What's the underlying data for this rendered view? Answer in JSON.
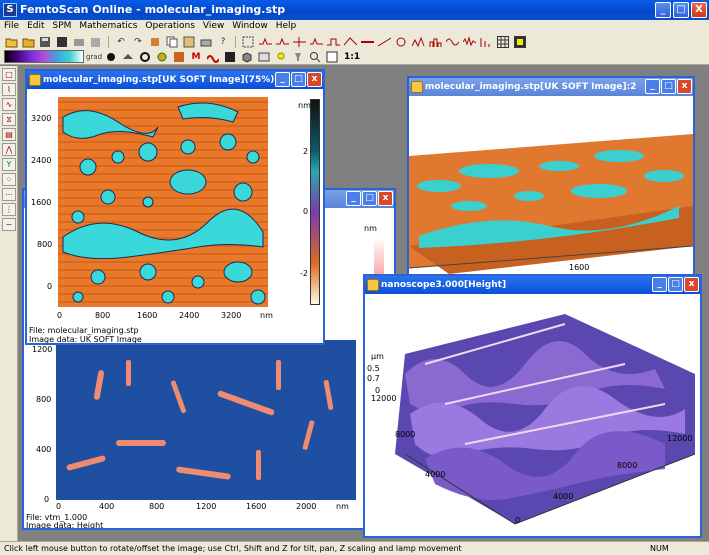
{
  "app": {
    "title": "FemtoScan Online - molecular_imaging.stp",
    "icon": "app-icon"
  },
  "window_buttons": [
    "_",
    "□",
    "X"
  ],
  "menu": [
    "File",
    "Edit",
    "SPM",
    "Mathematics",
    "Operations",
    "View",
    "Window",
    "Help"
  ],
  "toolbar": {
    "zoom_label": "1:1",
    "grad_label": "grad"
  },
  "status": {
    "text": "Click left mouse button to rotate/offset the image; use Ctrl, Shift and Z for tilt, pan, Z scaling and lamp movement",
    "num": "NUM"
  },
  "win1": {
    "title": "molecular_imaging.stp[UK SOFT Image](75%):1",
    "y_ticks": [
      "3200",
      "2400",
      "1600",
      "800",
      "0"
    ],
    "x_ticks": [
      "0",
      "800",
      "1600",
      "2400",
      "3200"
    ],
    "x_unit": "nm",
    "cbar_unit": "nm",
    "cbar_ticks": [
      "2",
      "0",
      "-2"
    ],
    "file": "File: molecular_imaging.stp",
    "image_data": "Image data: UK SOFT Image"
  },
  "win2": {
    "title": "molecular_imaging.stp[UK SOFT Image]:2",
    "tick": "1600"
  },
  "win3": {
    "cbar_unit": "nm",
    "y_ticks": [
      "1200",
      "800",
      "400",
      "0"
    ],
    "x_ticks": [
      "0",
      "400",
      "800",
      "1200",
      "1600",
      "2000"
    ],
    "x_unit": "nm",
    "file": "File: vtm_1.000",
    "image_data": "Image data: Height"
  },
  "win4": {
    "title": "nanoscope3.000[Height]",
    "z_unit": "µm",
    "z_ticks": [
      "0.5",
      "0.7",
      "0"
    ],
    "y_ticks": [
      "12000",
      "8000",
      "4000"
    ],
    "x_ticks": [
      "12000",
      "8000",
      "4000",
      "0"
    ]
  },
  "colors": {
    "titlebar": "#0a50d8",
    "desktop": "#808080",
    "chrome": "#ece9d8"
  }
}
